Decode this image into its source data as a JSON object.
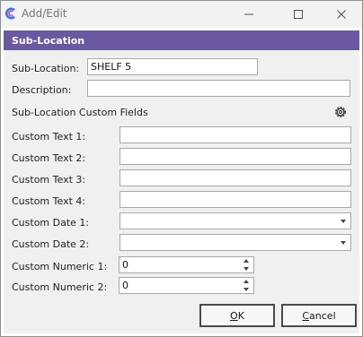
{
  "window": {
    "title": "Add/Edit",
    "app_icon": "c-logo-icon",
    "controls": [
      "minimize-icon",
      "maximize-icon",
      "close-icon"
    ],
    "accent_color": "#6a59a0"
  },
  "section": {
    "title": "Sub-Location"
  },
  "form": {
    "sub_location": {
      "label": "Sub-Location:",
      "value": "SHELF 5"
    },
    "description": {
      "label": "Description:",
      "value": ""
    },
    "custom_fields_heading": "Sub-Location Custom Fields",
    "settings_icon": "gear-icon",
    "custom_text_1": {
      "label": "Custom Text 1:",
      "value": ""
    },
    "custom_text_2": {
      "label": "Custom Text 2:",
      "value": ""
    },
    "custom_text_3": {
      "label": "Custom Text 3:",
      "value": ""
    },
    "custom_text_4": {
      "label": "Custom Text 4:",
      "value": ""
    },
    "custom_date_1": {
      "label": "Custom Date 1:",
      "value": ""
    },
    "custom_date_2": {
      "label": "Custom Date 2:",
      "value": ""
    },
    "custom_numeric_1": {
      "label": "Custom Numeric 1:",
      "value": "0"
    },
    "custom_numeric_2": {
      "label": "Custom Numeric 2:",
      "value": "0"
    }
  },
  "buttons": {
    "ok": {
      "mnemonic": "O",
      "rest": "K"
    },
    "cancel": {
      "mnemonic": "C",
      "rest": "ancel"
    }
  }
}
